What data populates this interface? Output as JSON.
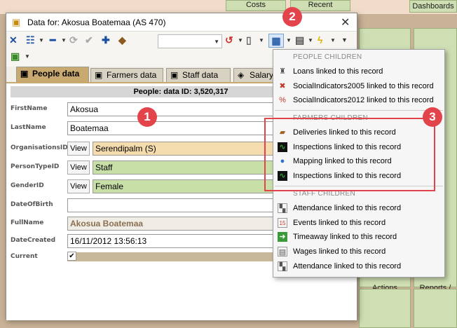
{
  "background": {
    "tiles": [
      {
        "label": "Costs"
      },
      {
        "label": "Recent"
      },
      {
        "label": "Dashboards"
      },
      {
        "label": "Actions"
      },
      {
        "label": "Reports /\nDashboards"
      }
    ]
  },
  "dialog": {
    "title": "Data for: Akosua Boatemaa (AS 470)",
    "close": "✕"
  },
  "tabs": [
    {
      "label": "People data",
      "active": true
    },
    {
      "label": "Farmers data",
      "active": false
    },
    {
      "label": "Staff data",
      "active": false
    },
    {
      "label": "Salary",
      "active": false
    }
  ],
  "form": {
    "header": "People: data ID: 3,520,317",
    "view_label": "View",
    "fields": {
      "first_name": {
        "label": "FirstName",
        "value": "Akosua"
      },
      "last_name": {
        "label": "LastName",
        "value": "Boatemaa"
      },
      "organisations": {
        "label": "OrganisationsID",
        "value": "Serendipalm (S)"
      },
      "person_type": {
        "label": "PersonTypeID",
        "value": "Staff"
      },
      "gender": {
        "label": "GenderID",
        "value": "Female"
      },
      "dob": {
        "label": "DateOfBirth",
        "value": ""
      },
      "full_name": {
        "label": "FullName",
        "value": "Akosua Boatemaa"
      },
      "date_created": {
        "label": "DateCreated",
        "value": "16/11/2012 13:56:13"
      },
      "current": {
        "label": "Current",
        "value": "✔"
      }
    }
  },
  "menu": {
    "sections": [
      {
        "title": "PEOPLE  CHILDREN",
        "items": [
          "Loans linked to this record",
          "SocialIndicators2005 linked to this record",
          "SocialIndicators2012 linked to this record"
        ]
      },
      {
        "title": "FARMERS  CHILDREN",
        "items": [
          "Deliveries linked to this record",
          "Inspections linked to this record",
          "Mapping linked to this record",
          "Inspections linked to this record"
        ]
      },
      {
        "title": "STAFF  CHILDREN",
        "items": [
          "Attendance linked to this record",
          "Events linked to this record",
          "Timeaway linked to this record",
          "Wages linked to this record",
          "Attendance linked to this record"
        ]
      }
    ]
  },
  "callouts": {
    "c1": "1",
    "c2": "2",
    "c3": "3"
  },
  "colors": {
    "accent_tab": "#c8a96f",
    "callout": "#e3434b",
    "highlight_border": "#e3434b",
    "org_field": "#f5dcae",
    "type_field": "#c8dfa8"
  }
}
